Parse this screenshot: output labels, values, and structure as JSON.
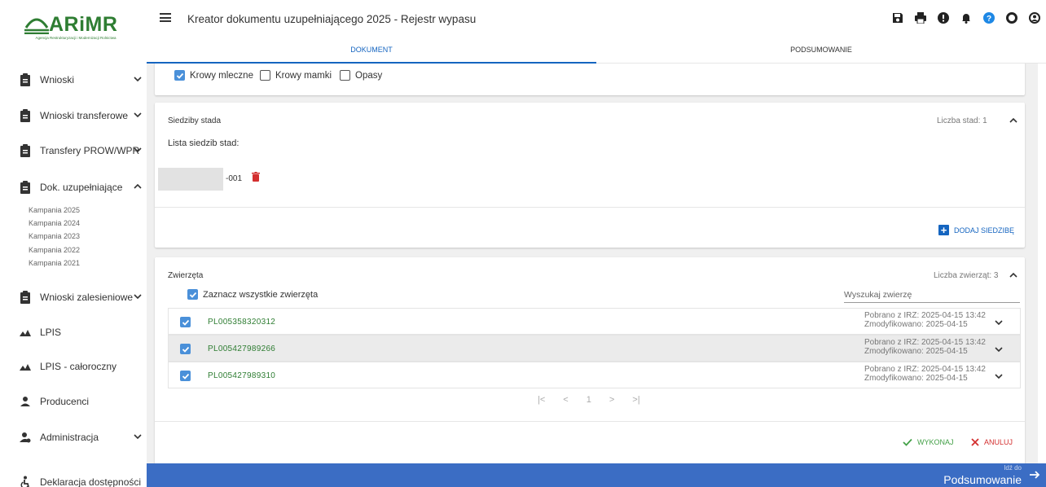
{
  "app": {
    "logo_text": "ARiMR",
    "logo_subtitle": "Agencja Restrukturyzacji i Modernizacji Rolnictwa",
    "title": "Kreator dokumentu uzupełniającego 2025 - Rejestr wypasu"
  },
  "header_icons": [
    "save-icon",
    "print-icon",
    "info-icon",
    "bell-icon",
    "help-icon",
    "circle-icon",
    "account-icon"
  ],
  "colors": {
    "primary": "#1565c0",
    "brand_green": "#2e7d32",
    "delete_red": "#d32f2f",
    "footer_blue": "#3b6dc4",
    "checkbox_blue": "#4a90d9"
  },
  "sidebar": {
    "items": [
      {
        "label": "Wnioski",
        "icon": "clipboard-icon",
        "chevron": "down"
      },
      {
        "label": "Wnioski transferowe",
        "icon": "clipboard-icon",
        "chevron": "down"
      },
      {
        "label": "Transfery PROW/WPR",
        "icon": "clipboard-icon",
        "chevron": "down"
      },
      {
        "label": "Dok. uzupełniające",
        "icon": "clipboard-icon",
        "chevron": "up"
      },
      {
        "label": "Wnioski zalesieniowe",
        "icon": "clipboard-icon",
        "chevron": "down"
      },
      {
        "label": "LPIS",
        "icon": "landscape-icon",
        "chevron": ""
      },
      {
        "label": "LPIS - całoroczny",
        "icon": "landscape-icon",
        "chevron": ""
      },
      {
        "label": "Producenci",
        "icon": "person-icon",
        "chevron": ""
      },
      {
        "label": "Administracja",
        "icon": "admin-icon",
        "chevron": "down"
      },
      {
        "label": "Deklaracja dostępności",
        "icon": "accessibility-icon",
        "chevron": ""
      }
    ],
    "subitems": [
      "Kampania 2025",
      "Kampania 2024",
      "Kampania 2023",
      "Kampania 2022",
      "Kampania 2021"
    ]
  },
  "tabs": [
    {
      "label": "DOKUMENT",
      "active": true
    },
    {
      "label": "PODSUMOWANIE",
      "active": false
    }
  ],
  "animal_types": [
    {
      "label": "Krowy mleczne",
      "checked": true
    },
    {
      "label": "Krowy mamki",
      "checked": false
    },
    {
      "label": "Opasy",
      "checked": false
    }
  ],
  "herd_locations": {
    "title": "Siedziby stada",
    "count_label": "Liczba stad: 1",
    "list_label": "Lista siedzib stad:",
    "items": [
      {
        "suffix": "-001"
      }
    ],
    "add_button": "DODAJ SIEDZIBĘ"
  },
  "animals": {
    "title": "Zwierzęta",
    "count_label": "Liczba zwierząt: 3",
    "select_all_label": "Zaznacz wszystkie zwierzęta",
    "select_all_checked": true,
    "search_placeholder": "Wyszukaj zwierzę",
    "rows": [
      {
        "id": "PL005358320312",
        "checked": true,
        "downloaded": "Pobrano z IRZ: 2025-04-15 13:42",
        "modified": "Zmodyfikowano: 2025-04-15",
        "highlighted": false
      },
      {
        "id": "PL005427989266",
        "checked": true,
        "downloaded": "Pobrano z IRZ: 2025-04-15 13:42",
        "modified": "Zmodyfikowano: 2025-04-15",
        "highlighted": true
      },
      {
        "id": "PL005427989310",
        "checked": true,
        "downloaded": "Pobrano z IRZ: 2025-04-15 13:42",
        "modified": "Zmodyfikowano: 2025-04-15",
        "highlighted": false
      }
    ],
    "pagination": {
      "first": "|<",
      "prev": "<",
      "page": "1",
      "next": ">",
      "last": ">|"
    }
  },
  "actions": {
    "execute": "WYKONAJ",
    "cancel": "ANULUJ"
  },
  "footer": {
    "go_to_small": "Idź do",
    "go_to_big": "Podsumowanie"
  }
}
